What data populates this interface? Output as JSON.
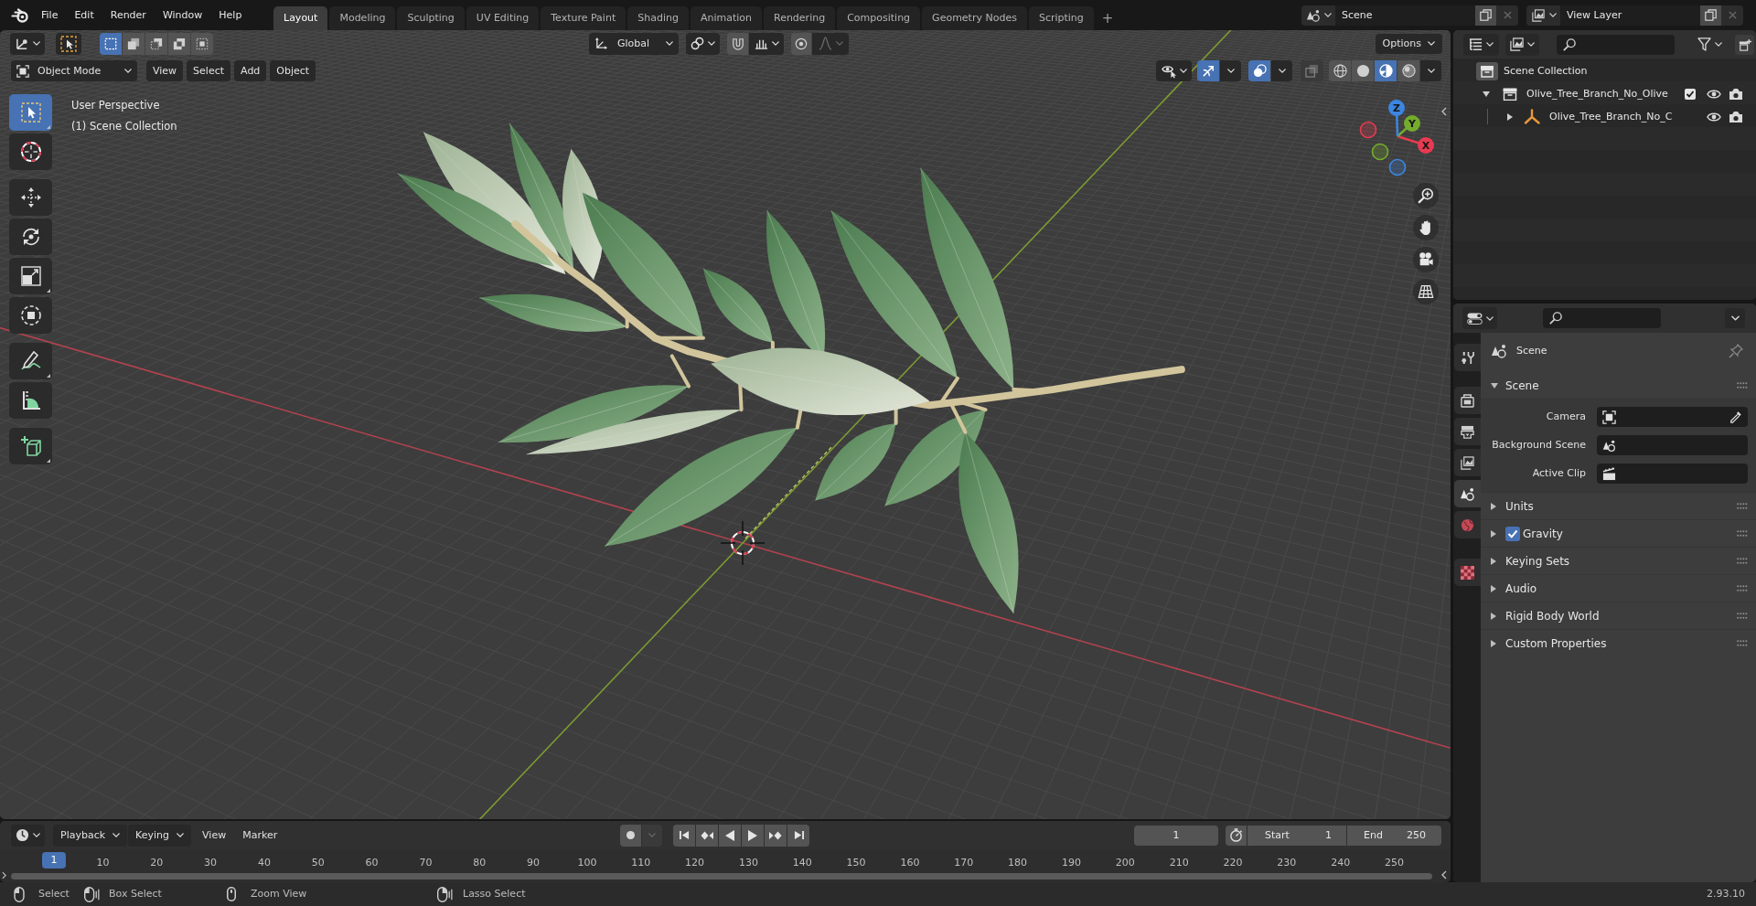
{
  "top_bar": {
    "menus": [
      "File",
      "Edit",
      "Render",
      "Window",
      "Help"
    ],
    "workspaces": [
      {
        "label": "Layout",
        "selected": true
      },
      {
        "label": "Modeling",
        "selected": false
      },
      {
        "label": "Sculpting",
        "selected": false
      },
      {
        "label": "UV Editing",
        "selected": false
      },
      {
        "label": "Texture Paint",
        "selected": false
      },
      {
        "label": "Shading",
        "selected": false
      },
      {
        "label": "Animation",
        "selected": false
      },
      {
        "label": "Rendering",
        "selected": false
      },
      {
        "label": "Compositing",
        "selected": false
      },
      {
        "label": "Geometry Nodes",
        "selected": false
      },
      {
        "label": "Scripting",
        "selected": false
      }
    ],
    "add_workspace": "+",
    "scene": "Scene",
    "view_layer": "View Layer"
  },
  "viewport": {
    "tool_header": {
      "select_modes": [
        {
          "kind": "set",
          "selected": true
        },
        {
          "kind": "extend",
          "selected": false
        },
        {
          "kind": "subtract",
          "selected": false
        },
        {
          "kind": "difference",
          "selected": false
        },
        {
          "kind": "intersect",
          "selected": false
        }
      ],
      "orientation": "Global",
      "snap": {
        "on": false
      },
      "proportional_editing": {
        "on": false
      },
      "options": "Options"
    },
    "header": {
      "mode": "Object Mode",
      "menus": [
        "View",
        "Select",
        "Add",
        "Object"
      ],
      "gizmos": {
        "on": true
      },
      "overlays": {
        "on": true
      },
      "xray": {
        "on": false
      },
      "shading_modes": [
        {
          "kind": "wireframe",
          "selected": false
        },
        {
          "kind": "solid",
          "selected": false
        },
        {
          "kind": "material",
          "selected": true
        },
        {
          "kind": "rendered",
          "selected": false
        }
      ]
    },
    "view_name": "User Perspective",
    "collection_name": "(1) Scene Collection",
    "tool_groups": [
      [
        {
          "kind": "select_box",
          "selected": true
        },
        {
          "kind": "cursor",
          "selected": false
        }
      ],
      [
        {
          "kind": "move",
          "selected": false
        },
        {
          "kind": "rotate",
          "selected": false
        },
        {
          "kind": "scale",
          "selected": false
        },
        {
          "kind": "transform",
          "selected": false
        }
      ],
      [
        {
          "kind": "annotate",
          "selected": false
        },
        {
          "kind": "measure",
          "selected": false
        }
      ],
      [
        {
          "kind": "add_cube",
          "selected": false
        }
      ]
    ],
    "gizmo_axes": [
      {
        "label": "X",
        "color": "#e63b50"
      },
      {
        "label": "Y",
        "color": "#74ac2c"
      },
      {
        "label": "Z",
        "color": "#3b86e2"
      }
    ]
  },
  "outliner": {
    "root": "Scene Collection",
    "items": [
      {
        "kind": "collection",
        "label": "Olive_Tree_Branch_No_Olive",
        "expanded": true,
        "checked": true,
        "children": [
          {
            "kind": "empty",
            "label": "Olive_Tree_Branch_No_C",
            "expanded": false
          }
        ]
      }
    ]
  },
  "properties": {
    "tabs": [
      {
        "kind": "tool",
        "selected": false
      },
      {
        "kind": "render",
        "selected": false
      },
      {
        "kind": "output",
        "selected": false
      },
      {
        "kind": "view_layer",
        "selected": false
      },
      {
        "kind": "scene",
        "selected": true
      },
      {
        "kind": "world",
        "selected": false
      },
      {
        "kind": "texture",
        "selected": false
      }
    ],
    "context": "Scene",
    "panels": [
      {
        "title": "Scene",
        "expanded": true,
        "fields": [
          {
            "kind": "camera",
            "label": "Camera"
          },
          {
            "kind": "scene",
            "label": "Background Scene"
          },
          {
            "kind": "clip",
            "label": "Active Clip"
          }
        ]
      },
      {
        "title": "Units",
        "expanded": false
      },
      {
        "title": "Gravity",
        "expanded": false,
        "checked": true
      },
      {
        "title": "Keying Sets",
        "expanded": false
      },
      {
        "title": "Audio",
        "expanded": false
      },
      {
        "title": "Rigid Body World",
        "expanded": false
      },
      {
        "title": "Custom Properties",
        "expanded": false
      }
    ]
  },
  "timeline": {
    "menus": [
      {
        "kind": "dropdown",
        "label": "Playback"
      },
      {
        "kind": "dropdown",
        "label": "Keying"
      },
      {
        "kind": "menu",
        "label": "View"
      },
      {
        "kind": "menu",
        "label": "Marker"
      }
    ],
    "auto_keying": {
      "on": false
    },
    "current_frame": "1",
    "start": {
      "label": "Start",
      "value": "1"
    },
    "end": {
      "label": "End",
      "value": "250"
    },
    "playhead": "1",
    "frame_labels": [
      "10",
      "20",
      "30",
      "40",
      "50",
      "60",
      "70",
      "80",
      "90",
      "100",
      "110",
      "120",
      "130",
      "140",
      "150",
      "160",
      "170",
      "180",
      "190",
      "200",
      "210",
      "220",
      "230",
      "240",
      "250"
    ]
  },
  "status_bar": {
    "hints": [
      {
        "kind": "left_click",
        "label": "Select"
      },
      {
        "kind": "left_drag",
        "label": "Box Select"
      },
      {
        "kind": "middle_click",
        "label": "Zoom View"
      },
      {
        "kind": "right_drag",
        "label": "Lasso Select"
      }
    ],
    "version": "2.93.10"
  }
}
